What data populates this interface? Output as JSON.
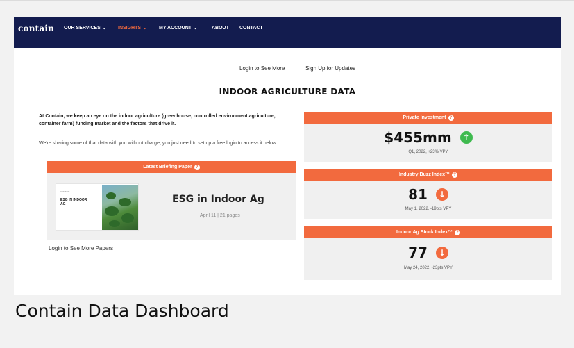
{
  "nav": {
    "logo": "contain",
    "items": [
      {
        "label": "OUR SERVICES",
        "chevron": "⌄"
      },
      {
        "label": "INSIGHTS",
        "chevron": "⌄"
      },
      {
        "label": "MY ACCOUNT",
        "chevron": "⌄"
      },
      {
        "label": "ABOUT"
      },
      {
        "label": "CONTACT"
      }
    ],
    "accent": "#f26a3e",
    "background": "#131c4f"
  },
  "toplinks": {
    "login": "Login to See More",
    "signup": "Sign Up for Updates"
  },
  "page_title": "INDOOR AGRICULTURE DATA",
  "intro": {
    "bold": "At Contain, we keep an eye on the indoor agriculture (greenhouse, controlled environment agriculture, container farm) funding market and the factors that drive it.",
    "text": "We're sharing some of that data with you without charge, you just need to set up a free login to access it below."
  },
  "briefing": {
    "header": "Latest Briefing Paper",
    "help_icon": "?",
    "thumb_sub": "CONTAIN",
    "thumb_title": "ESG IN INDOOR AG",
    "title": "ESG in Indoor Ag",
    "meta": "April 11 | 21 pages",
    "more": "Login to See More Papers"
  },
  "stats": [
    {
      "header": "Private Investment",
      "value": "$455mm",
      "trend": "up",
      "trend_glyph": "↑",
      "trend_color": "#3fba4f",
      "note": "Q1, 2022, +23% VPY"
    },
    {
      "header": "Industry Buzz Index™",
      "value": "81",
      "trend": "down",
      "trend_glyph": "↓",
      "trend_color": "#f26a3e",
      "note": "May 1, 2022, -19pts VPY"
    },
    {
      "header": "Indoor Ag Stock Index™",
      "value": "77",
      "trend": "down",
      "trend_glyph": "↓",
      "trend_color": "#f26a3e",
      "note": "May 24, 2022, -23pts VPY"
    }
  ],
  "caption": "Contain Data Dashboard"
}
